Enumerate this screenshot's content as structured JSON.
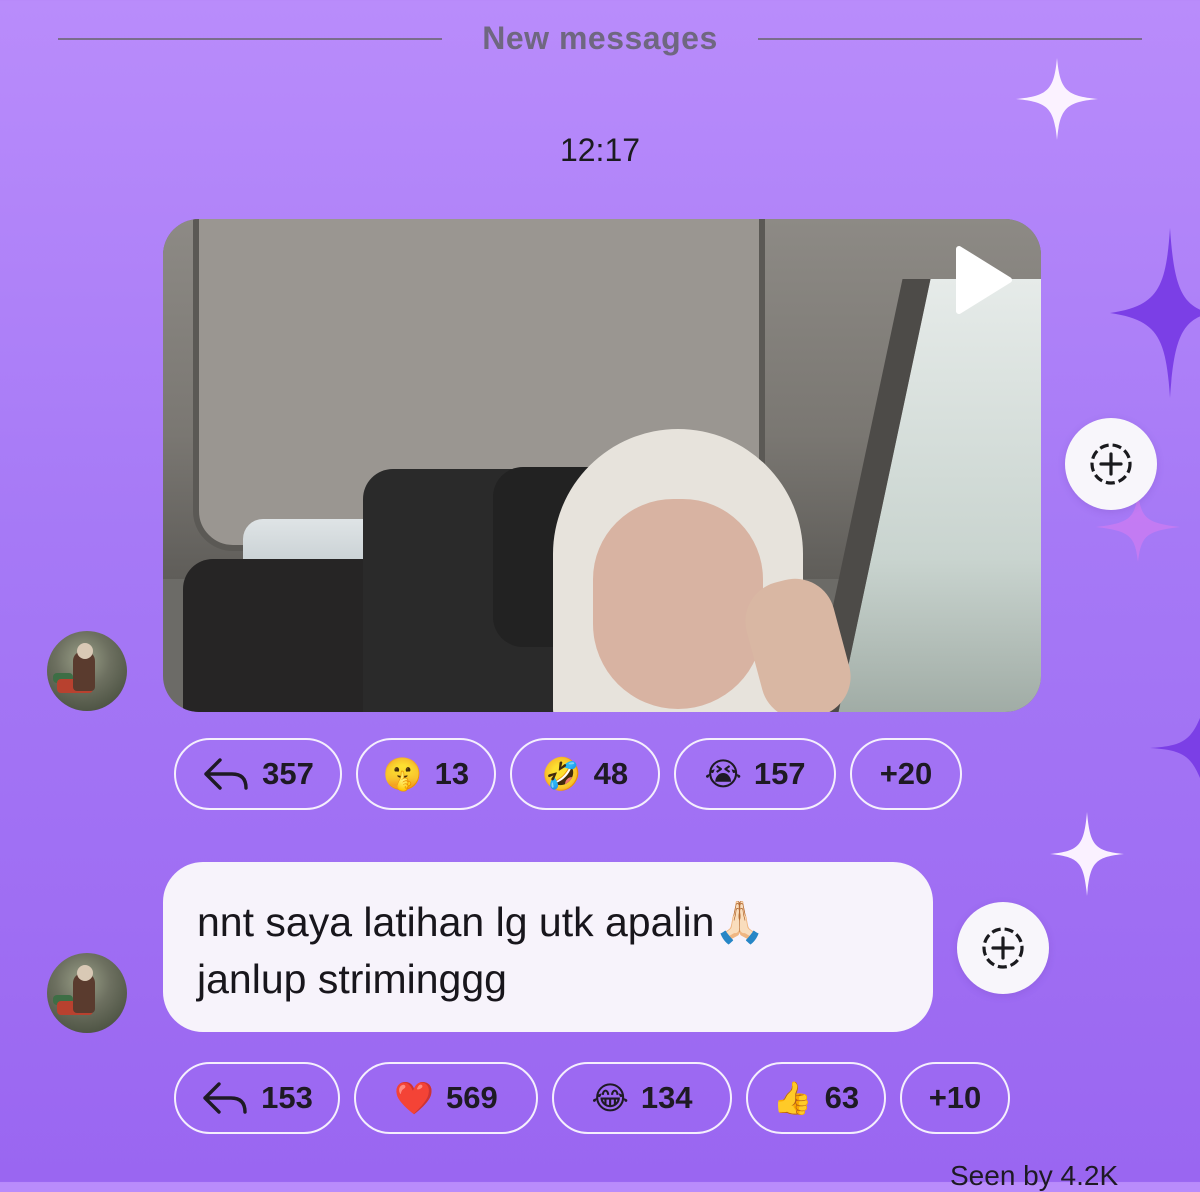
{
  "header": {
    "new_messages_label": "New messages",
    "timestamp": "12:17"
  },
  "messages": [
    {
      "type": "video",
      "icons": {
        "play": "play-icon",
        "share": "share-plus-icon"
      },
      "reactions": [
        {
          "icon": "reply-arrow-icon",
          "emoji": "",
          "count": "357"
        },
        {
          "icon": "shushing-face-icon",
          "emoji": "🤫",
          "count": "13"
        },
        {
          "icon": "rofl-face-icon",
          "emoji": "🤣",
          "count": "48"
        },
        {
          "icon": "loudly-crying-face-icon",
          "emoji": "😭",
          "count": "157"
        },
        {
          "icon": "",
          "emoji": "",
          "count": "+20"
        }
      ]
    },
    {
      "type": "text",
      "text_line1": "nnt saya latihan lg utk apalin🙏🏻",
      "text_line2": "janlup striminggg",
      "icons": {
        "share": "share-plus-icon"
      },
      "reactions": [
        {
          "icon": "reply-arrow-icon",
          "emoji": "",
          "count": "153"
        },
        {
          "icon": "red-heart-icon",
          "emoji": "❤️",
          "count": "569"
        },
        {
          "icon": "tears-of-joy-face-icon",
          "emoji": "😂",
          "count": "134"
        },
        {
          "icon": "thumbs-up-icon",
          "emoji": "👍",
          "count": "63"
        },
        {
          "icon": "",
          "emoji": "",
          "count": "+10"
        }
      ]
    }
  ],
  "footer": {
    "seen_by": "Seen by 4.2K"
  },
  "colors": {
    "background_top": "#b98cfb",
    "background_bottom": "#9a66f1",
    "bubble": "#f7f3fb",
    "pill_border": "#f5effd"
  }
}
